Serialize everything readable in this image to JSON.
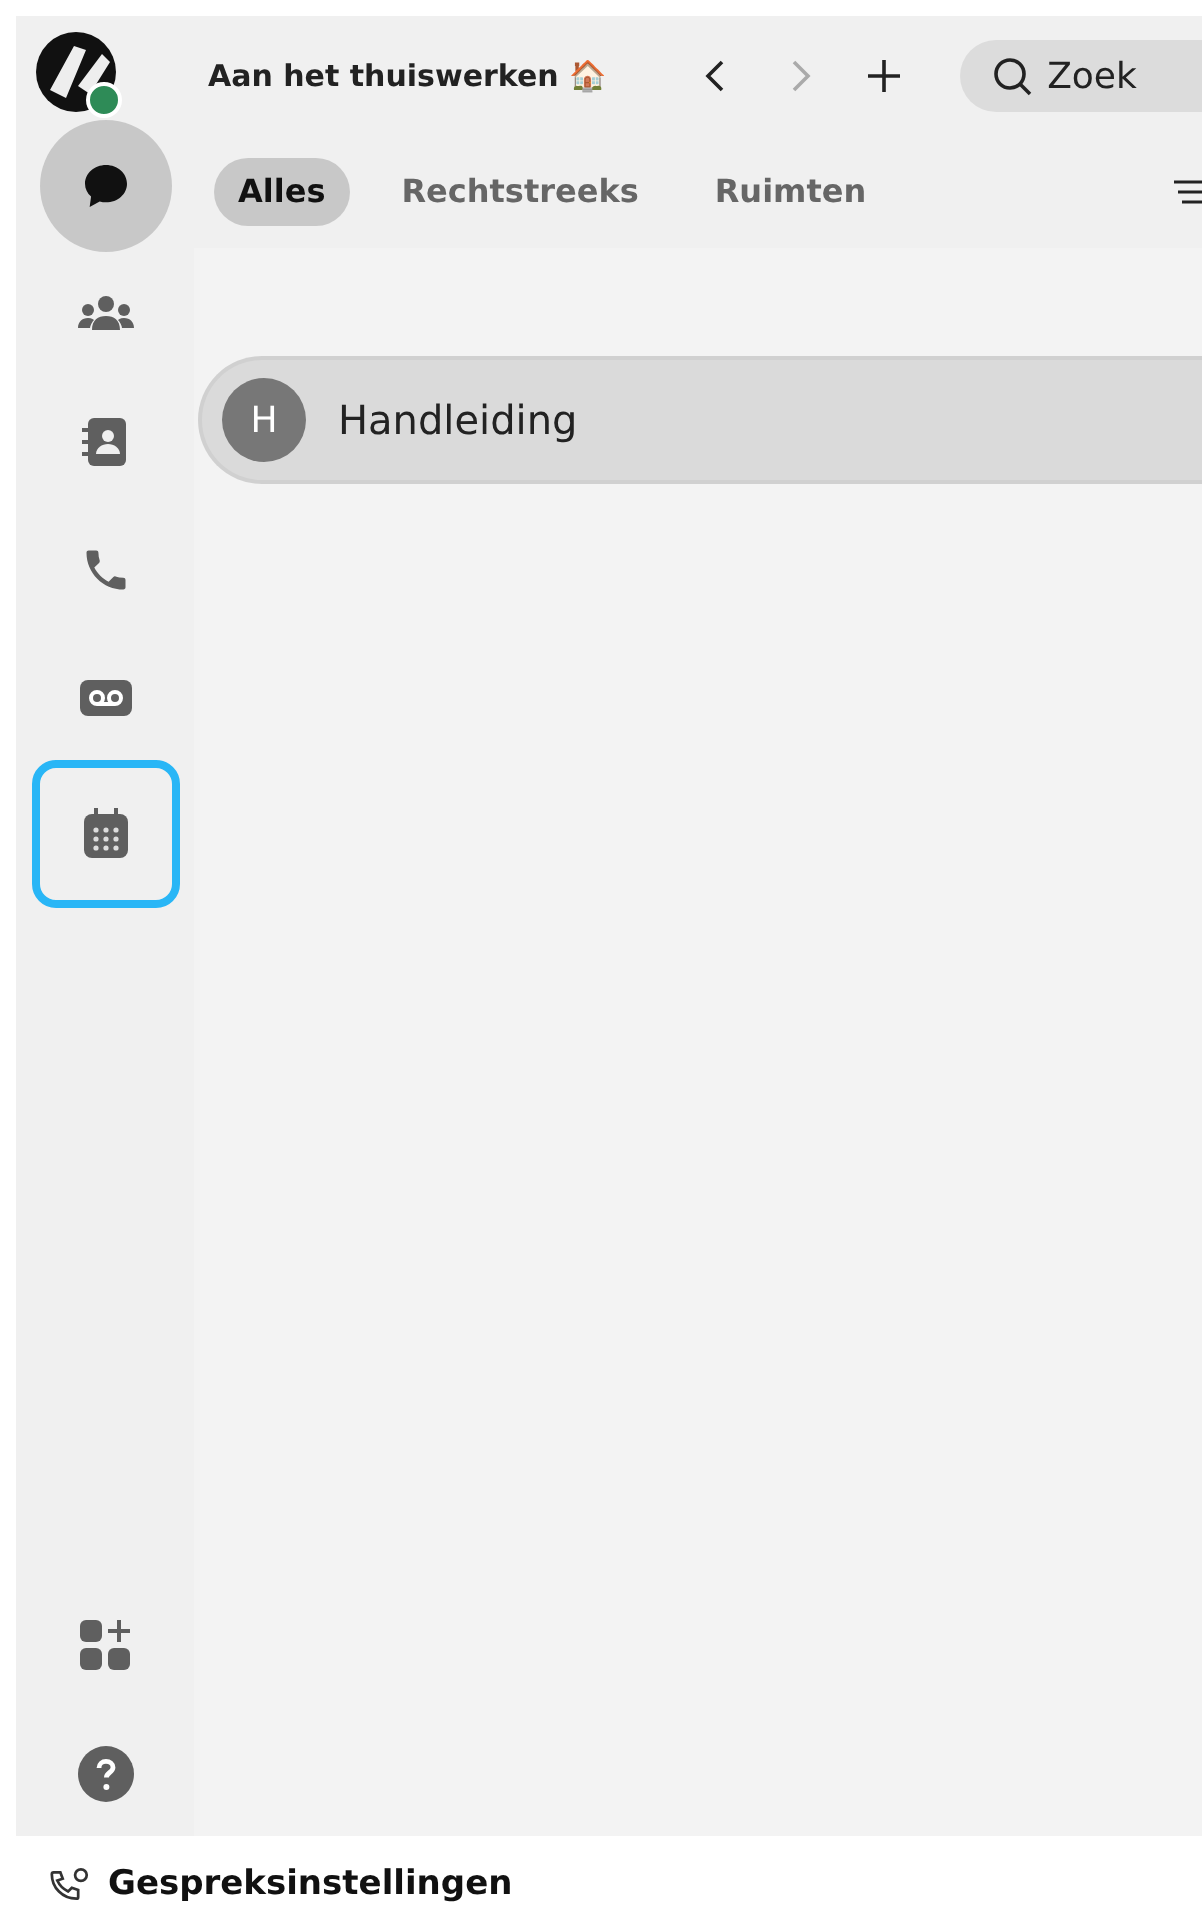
{
  "user": {
    "online": true
  },
  "header": {
    "title": "Aan het thuiswerken 🏠",
    "back_disabled": false,
    "forward_disabled": true,
    "search": {
      "placeholder": "Zoek"
    }
  },
  "rail": [
    {
      "kind": "chat",
      "selected": true,
      "focused": false
    },
    {
      "kind": "teams",
      "selected": false,
      "focused": false
    },
    {
      "kind": "contacts",
      "selected": false,
      "focused": false
    },
    {
      "kind": "calls",
      "selected": false,
      "focused": false
    },
    {
      "kind": "voicemail",
      "selected": false,
      "focused": false
    },
    {
      "kind": "calendar",
      "selected": false,
      "focused": true
    }
  ],
  "rail_bottom": [
    {
      "kind": "apps"
    },
    {
      "kind": "help"
    }
  ],
  "tabs": [
    {
      "label": "Alles",
      "selected": true
    },
    {
      "label": "Rechtstreeks",
      "selected": false
    },
    {
      "label": "Ruimten",
      "selected": false
    }
  ],
  "spaces": [
    {
      "initial": "H",
      "name": "Handleiding"
    }
  ],
  "footer": {
    "label": "Gespreksinstellingen"
  }
}
